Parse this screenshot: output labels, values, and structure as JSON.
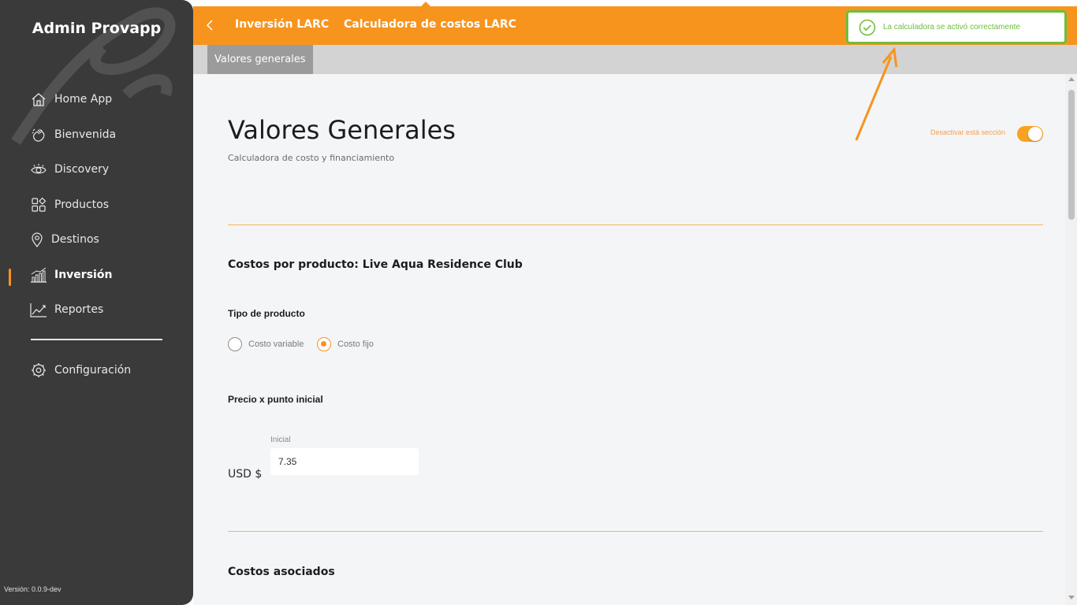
{
  "sidebar": {
    "brand": "Admin Provapp",
    "items": [
      {
        "label": "Home App",
        "icon": "house-icon"
      },
      {
        "label": "Bienvenida",
        "icon": "waving-hand-icon"
      },
      {
        "label": "Discovery",
        "icon": "eye-icon"
      },
      {
        "label": "Productos",
        "icon": "grid-shapes-icon"
      },
      {
        "label": "Destinos",
        "icon": "map-pin-icon"
      },
      {
        "label": "Inversión",
        "icon": "bar-chart-icon",
        "active": true
      },
      {
        "label": "Reportes",
        "icon": "line-chart-icon"
      }
    ],
    "settings": {
      "label": "Configuración",
      "icon": "gear-icon"
    },
    "version": "Versión: 0.0.9-dev"
  },
  "topbar": {
    "crumbs": [
      "Inversión LARC",
      "Calculadora de costos LARC"
    ],
    "accent": "#f7941d"
  },
  "subbar": {
    "tab": "Valores generales"
  },
  "main": {
    "title": "Valores Generales",
    "subtitle": "Calculadora de costo y financiamiento",
    "toggle_label": "Desactivar está sección",
    "toggle_on": true,
    "section1_title": "Costos por producto: Live Aqua Residence Club",
    "tipo_label": "Tipo de producto",
    "radios": [
      {
        "label": "Costo variable",
        "checked": false
      },
      {
        "label": "Costo fijo",
        "checked": true
      }
    ],
    "precio_label": "Precio x punto inicial",
    "input_label": "Inicial",
    "input_value": "7.35",
    "currency": "USD $",
    "section2_title": "Costos asociados"
  },
  "toast": {
    "message": "La calculadora se activó correctamente",
    "color": "#6cbf3a"
  }
}
